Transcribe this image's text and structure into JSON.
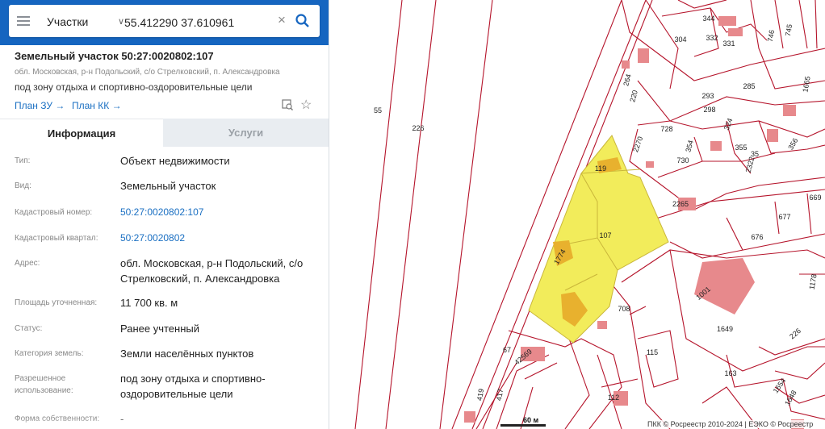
{
  "search": {
    "layer": "Участки",
    "query": "55.412290 37.610961"
  },
  "object": {
    "title": "Земельный участок 50:27:0020802:107",
    "address_short": "обл. Московская, р-н Подольский, с/о Стрелковский, п. Александровка",
    "permitted_use_short": "под зону отдыха и спортивно-оздоровительные цели",
    "links": {
      "plan_zu": "План ЗУ →",
      "plan_kk": "План КК →"
    }
  },
  "tabs": {
    "info": "Информация",
    "services": "Услуги"
  },
  "fields": [
    {
      "label": "Тип:",
      "value": "Объект недвижимости",
      "style": ""
    },
    {
      "label": "Вид:",
      "value": "Земельный участок",
      "style": ""
    },
    {
      "label": "Кадастровый номер:",
      "value": "50:27:0020802:107",
      "style": "blue"
    },
    {
      "label": "Кадастровый квартал:",
      "value": "50:27:0020802",
      "style": "blue"
    },
    {
      "label": "Адрес:",
      "value": "обл. Московская, р-н Подольский, с/о Стрелковский, п. Александровка",
      "style": ""
    },
    {
      "label": "Площадь уточненная:",
      "value": "11 700 кв. м",
      "style": ""
    },
    {
      "label": "Статус:",
      "value": "Ранее учтенный",
      "style": ""
    },
    {
      "label": "Категория земель:",
      "value": "Земли населённых пунктов",
      "style": ""
    },
    {
      "label": "Разрешенное использование:",
      "value": "под зону отдыха и спортивно-оздоровительные цели",
      "style": ""
    },
    {
      "label": "Форма собственности:",
      "value": "-",
      "style": "grey"
    }
  ],
  "map": {
    "parcel_labels": [
      "55",
      "226",
      "344",
      "304",
      "332",
      "331",
      "746",
      "745",
      "264",
      "220",
      "293",
      "285",
      "298",
      "324",
      "1665",
      "2270",
      "728",
      "354",
      "355",
      "35",
      "356",
      "730",
      "2322",
      "669",
      "119",
      "2265",
      "107",
      "677",
      "1774",
      "676",
      "1001",
      "1178",
      "708",
      "1649",
      "226",
      "67",
      "42569",
      "115",
      "1654",
      "163",
      "419",
      "417",
      "112",
      "1648"
    ],
    "scale_label": "60 м",
    "copyright": "ПКК © Росреестр 2010-2024 | ЕЭКО © Росреестр",
    "colors": {
      "boundary": "#b5142b",
      "parcel_fill": "#ffffff",
      "building": "#e7898c",
      "selected": "#f2ec5b",
      "selected_building": "#e8b12e"
    }
  }
}
